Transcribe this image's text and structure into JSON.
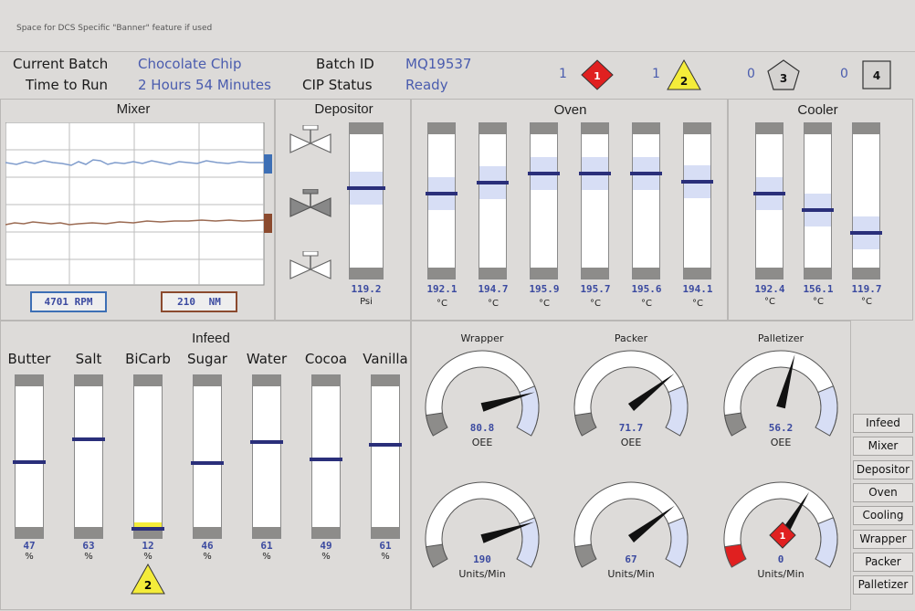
{
  "banner": "Space for DCS Specific \"Banner\" feature if used",
  "header": {
    "current_batch_label": "Current Batch",
    "current_batch_value": "Chocolate Chip",
    "time_to_run_label": "Time to Run",
    "time_to_run_value": "2 Hours 54 Minutes",
    "batch_id_label": "Batch ID",
    "batch_id_value": "MQ19537",
    "cip_status_label": "CIP Status",
    "cip_status_value": "Ready"
  },
  "alarms": [
    {
      "count": "1",
      "symbol": "1",
      "shape": "diamond",
      "color": "#e02020"
    },
    {
      "count": "1",
      "symbol": "2",
      "shape": "triangle",
      "color": "#f4ec3a"
    },
    {
      "count": "0",
      "symbol": "3",
      "shape": "pentagon",
      "color": "#d4d2d0"
    },
    {
      "count": "0",
      "symbol": "4",
      "shape": "square",
      "color": "#d4d2d0"
    }
  ],
  "mixer": {
    "title": "Mixer",
    "rpm_value": "4701",
    "rpm_unit": "RPM",
    "nm_value": "210",
    "nm_unit": "NM",
    "rpm_color": "#3d6fb5",
    "nm_color": "#8b4a2e"
  },
  "depositor": {
    "title": "Depositor",
    "value": "119.2",
    "unit": "Psi",
    "level": 0.6
  },
  "oven": {
    "title": "Oven",
    "unit": "°C",
    "zones": [
      {
        "value": "192.1",
        "level": 0.56
      },
      {
        "value": "194.7",
        "level": 0.64
      },
      {
        "value": "195.9",
        "level": 0.71
      },
      {
        "value": "195.7",
        "level": 0.71
      },
      {
        "value": "195.6",
        "level": 0.71
      },
      {
        "value": "194.1",
        "level": 0.65
      }
    ]
  },
  "cooler": {
    "title": "Cooler",
    "unit": "°C",
    "zones": [
      {
        "value": "192.4",
        "level": 0.56
      },
      {
        "value": "156.1",
        "level": 0.44
      },
      {
        "value": "119.7",
        "level": 0.27
      }
    ]
  },
  "infeed": {
    "title": "Infeed",
    "unit": "%",
    "items": [
      {
        "label": "Butter",
        "value": "47",
        "level": 0.47
      },
      {
        "label": "Salt",
        "value": "63",
        "level": 0.63
      },
      {
        "label": "BiCarb",
        "value": "12",
        "level": 0.0,
        "alarm": "2"
      },
      {
        "label": "Sugar",
        "value": "46",
        "level": 0.46
      },
      {
        "label": "Water",
        "value": "61",
        "level": 0.61
      },
      {
        "label": "Cocoa",
        "value": "49",
        "level": 0.49
      },
      {
        "label": "Vanilla",
        "value": "61",
        "level": 0.59
      }
    ]
  },
  "gauges": {
    "top": [
      {
        "title": "Wrapper",
        "value": "80.8",
        "unit": "OEE",
        "level": 0.808
      },
      {
        "title": "Packer",
        "value": "71.7",
        "unit": "OEE",
        "level": 0.717
      },
      {
        "title": "Palletizer",
        "value": "56.2",
        "unit": "OEE",
        "level": 0.562
      }
    ],
    "bottom": [
      {
        "value": "190",
        "unit": "Units/Min",
        "level": 0.8
      },
      {
        "value": "67",
        "unit": "Units/Min",
        "level": 0.72
      },
      {
        "value": "0",
        "unit": "Units/Min",
        "level": 0.63,
        "alarm": "1"
      }
    ]
  },
  "nav": [
    "Infeed",
    "Mixer",
    "Depositor",
    "Oven",
    "Cooling",
    "Wrapper",
    "Packer",
    "Palletizer"
  ]
}
